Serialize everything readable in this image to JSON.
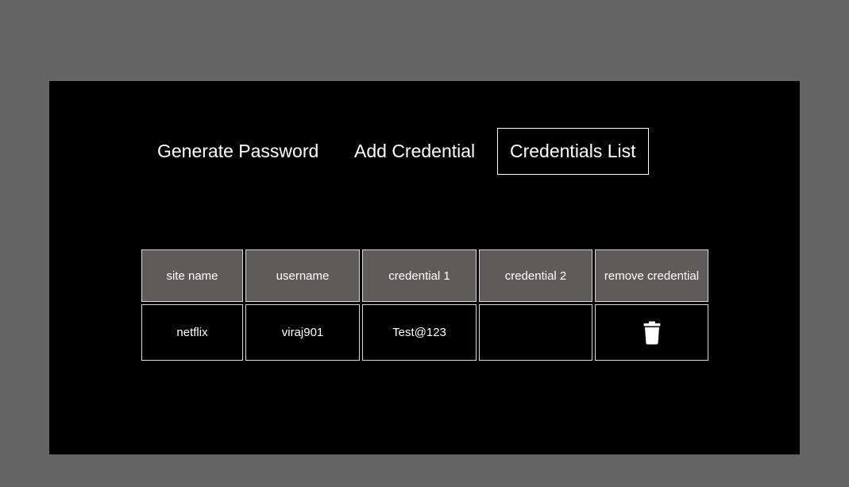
{
  "nav": {
    "items": [
      {
        "label": "Generate Password"
      },
      {
        "label": "Add Credential"
      },
      {
        "label": "Credentials List"
      }
    ],
    "active_index": 2
  },
  "table": {
    "headers": [
      "site name",
      "username",
      "credential 1",
      "credential 2",
      "remove credential"
    ],
    "rows": [
      {
        "site_name": "netflix",
        "username": "viraj901",
        "credential_1": "Test@123",
        "credential_2": "",
        "remove_icon": "trash-icon"
      }
    ]
  },
  "colors": {
    "background": "#646464",
    "panel": "#000000",
    "header_cell": "#5f5b5a",
    "text": "#ffffff",
    "border": "#d8d8d8"
  }
}
